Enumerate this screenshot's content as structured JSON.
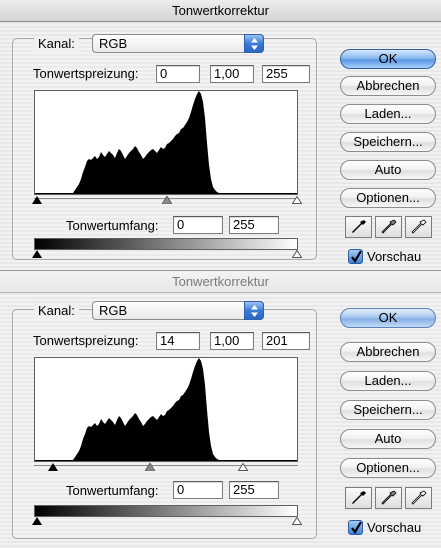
{
  "dialogs": [
    {
      "title": "Tonwertkorrektur",
      "channel_label": "Kanal:",
      "channel_value": "RGB",
      "input_levels_label": "Tonwertspreizung:",
      "input_black": "0",
      "input_gamma": "1,00",
      "input_white": "255",
      "output_levels_label": "Tonwertumfang:",
      "output_black": "0",
      "output_white": "255",
      "buttons": {
        "ok": "OK",
        "cancel": "Abbrechen",
        "load": "Laden...",
        "save": "Speichern...",
        "auto": "Auto",
        "options": "Optionen..."
      },
      "preview_label": "Vorschau",
      "preview_checked": true
    },
    {
      "title": "Tonwertkorrektur",
      "channel_label": "Kanal:",
      "channel_value": "RGB",
      "input_levels_label": "Tonwertspreizung:",
      "input_black": "14",
      "input_gamma": "1,00",
      "input_white": "201",
      "output_levels_label": "Tonwertumfang:",
      "output_black": "0",
      "output_white": "255",
      "buttons": {
        "ok": "OK",
        "cancel": "Abbrechen",
        "load": "Laden...",
        "save": "Speichern...",
        "auto": "Auto",
        "options": "Optionen..."
      },
      "preview_label": "Vorschau",
      "preview_checked": true
    }
  ],
  "colors": {
    "accent": "#3b7ad6",
    "histogram": "#000000"
  },
  "icons": {
    "channel_popup": "up-down-arrows-icon",
    "black_eyedropper": "black-eyedropper-icon",
    "gray_eyedropper": "gray-eyedropper-icon",
    "white_eyedropper": "white-eyedropper-icon",
    "checkmark": "checkmark-icon"
  }
}
